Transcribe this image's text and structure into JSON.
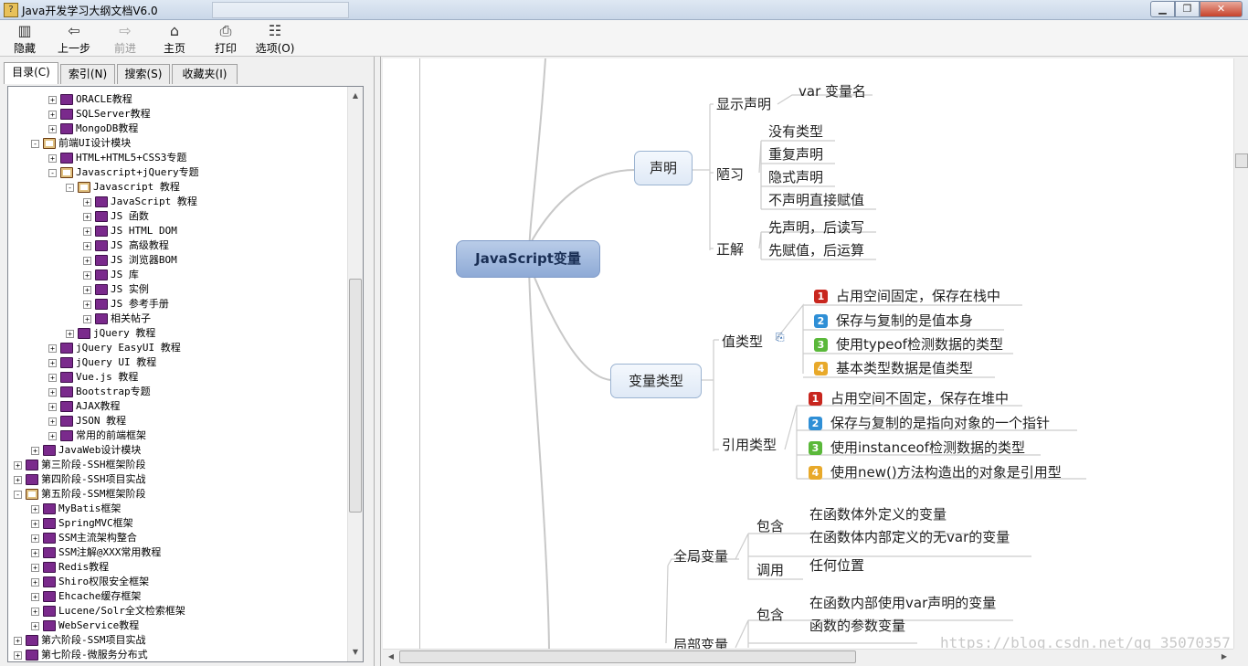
{
  "window": {
    "title": "Java开发学习大纲文档V6.0",
    "close_glyph": "✕",
    "max_glyph": "❐",
    "min_glyph": "▁"
  },
  "toolbar": {
    "hide": "隐藏",
    "back": "上一步",
    "forward": "前进",
    "home": "主页",
    "print": "打印",
    "options": "选项(O)"
  },
  "tabs": [
    "目录(C)",
    "索引(N)",
    "搜索(S)",
    "收藏夹(I)"
  ],
  "tree": [
    {
      "label": "ORACLE教程",
      "indent": 2,
      "icon": "book",
      "pm": "+"
    },
    {
      "label": "SQLServer教程",
      "indent": 2,
      "icon": "book",
      "pm": "+"
    },
    {
      "label": "MongoDB教程",
      "indent": 2,
      "icon": "book",
      "pm": "+"
    },
    {
      "label": "前端UI设计模块",
      "indent": 1,
      "icon": "open",
      "pm": "-"
    },
    {
      "label": "HTML+HTML5+CSS3专题",
      "indent": 2,
      "icon": "book",
      "pm": "+"
    },
    {
      "label": "Javascript+jQuery专题",
      "indent": 2,
      "icon": "open",
      "pm": "-"
    },
    {
      "label": "Javascript 教程",
      "indent": 3,
      "icon": "open",
      "pm": "-"
    },
    {
      "label": "JavaScript 教程",
      "indent": 4,
      "icon": "book",
      "pm": "+"
    },
    {
      "label": "JS 函数",
      "indent": 4,
      "icon": "book",
      "pm": "+"
    },
    {
      "label": "JS HTML DOM",
      "indent": 4,
      "icon": "book",
      "pm": "+"
    },
    {
      "label": "JS 高级教程",
      "indent": 4,
      "icon": "book",
      "pm": "+"
    },
    {
      "label": "JS 浏览器BOM",
      "indent": 4,
      "icon": "book",
      "pm": "+"
    },
    {
      "label": "JS 库",
      "indent": 4,
      "icon": "book",
      "pm": "+"
    },
    {
      "label": "JS 实例",
      "indent": 4,
      "icon": "book",
      "pm": "+"
    },
    {
      "label": "JS 参考手册",
      "indent": 4,
      "icon": "book",
      "pm": "+"
    },
    {
      "label": "相关帖子",
      "indent": 4,
      "icon": "book",
      "pm": "+"
    },
    {
      "label": "jQuery 教程",
      "indent": 3,
      "icon": "book",
      "pm": "+"
    },
    {
      "label": "jQuery EasyUI 教程",
      "indent": 2,
      "icon": "book",
      "pm": "+"
    },
    {
      "label": "jQuery UI 教程",
      "indent": 2,
      "icon": "book",
      "pm": "+"
    },
    {
      "label": "Vue.js 教程",
      "indent": 2,
      "icon": "book",
      "pm": "+"
    },
    {
      "label": "Bootstrap专题",
      "indent": 2,
      "icon": "book",
      "pm": "+"
    },
    {
      "label": "AJAX教程",
      "indent": 2,
      "icon": "book",
      "pm": "+"
    },
    {
      "label": "JSON 教程",
      "indent": 2,
      "icon": "book",
      "pm": "+"
    },
    {
      "label": "常用的前端框架",
      "indent": 2,
      "icon": "book",
      "pm": "+"
    },
    {
      "label": "JavaWeb设计模块",
      "indent": 1,
      "icon": "book",
      "pm": "+"
    },
    {
      "label": "第三阶段-SSH框架阶段",
      "indent": 0,
      "icon": "book",
      "pm": "+"
    },
    {
      "label": "第四阶段-SSH项目实战",
      "indent": 0,
      "icon": "book",
      "pm": "+"
    },
    {
      "label": "第五阶段-SSM框架阶段",
      "indent": 0,
      "icon": "open",
      "pm": "-"
    },
    {
      "label": "MyBatis框架",
      "indent": 1,
      "icon": "book",
      "pm": "+"
    },
    {
      "label": "SpringMVC框架",
      "indent": 1,
      "icon": "book",
      "pm": "+"
    },
    {
      "label": "SSM主流架构整合",
      "indent": 1,
      "icon": "book",
      "pm": "+"
    },
    {
      "label": "SSM注解@XXX常用教程",
      "indent": 1,
      "icon": "book",
      "pm": "+"
    },
    {
      "label": "Redis教程",
      "indent": 1,
      "icon": "book",
      "pm": "+"
    },
    {
      "label": "Shiro权限安全框架",
      "indent": 1,
      "icon": "book",
      "pm": "+"
    },
    {
      "label": "Ehcache缓存框架",
      "indent": 1,
      "icon": "book",
      "pm": "+"
    },
    {
      "label": "Lucene/Solr全文检索框架",
      "indent": 1,
      "icon": "book",
      "pm": "+"
    },
    {
      "label": "WebService教程",
      "indent": 1,
      "icon": "book",
      "pm": "+"
    },
    {
      "label": "第六阶段-SSM项目实战",
      "indent": 0,
      "icon": "book",
      "pm": "+"
    },
    {
      "label": "第七阶段-微服务分布式",
      "indent": 0,
      "icon": "book",
      "pm": "+"
    }
  ],
  "map": {
    "root": "JavaScript变量",
    "decl": "声明",
    "decl_show": "显示声明",
    "decl_show_item": "var 变量名",
    "decl_bad": "陋习",
    "decl_bad_items": [
      "没有类型",
      "重复声明",
      "隐式声明",
      "不声明直接赋值"
    ],
    "decl_good": "正解",
    "decl_good_items": [
      "先声明，后读写",
      "先赋值，后运算"
    ],
    "vtype": "变量类型",
    "value_type": "值类型",
    "value_items": [
      "占用空间固定，保存在栈中",
      "保存与复制的是值本身",
      "使用typeof检测数据的类型",
      "基本类型数据是值类型"
    ],
    "ref_type": "引用类型",
    "ref_items": [
      "占用空间不固定，保存在堆中",
      "保存与复制的是指向对象的一个指针",
      "使用instanceof检测数据的类型",
      "使用new()方法构造出的对象是引用型"
    ],
    "global": "全局变量",
    "contain": "包含",
    "global_items": [
      "在函数体外定义的变量",
      "在函数体内部定义的无var的变量"
    ],
    "call": "调用",
    "call_item": "任何位置",
    "local": "局部变量",
    "local_items": [
      "在函数内部使用var声明的变量",
      "函数的参数变量"
    ],
    "numbers": [
      "1",
      "2",
      "3",
      "4"
    ]
  },
  "watermark": "https://blog.csdn.net/qq_35070357"
}
